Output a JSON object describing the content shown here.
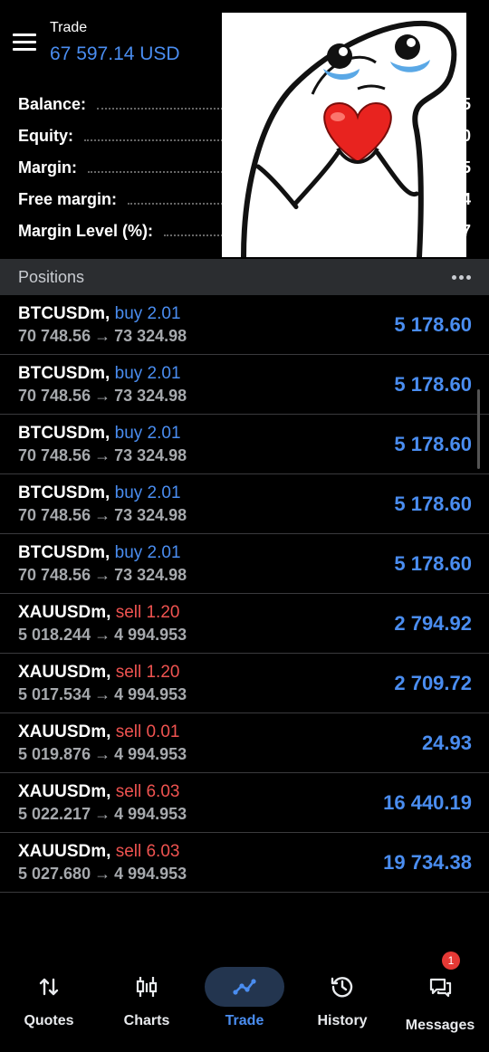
{
  "header": {
    "title": "Trade",
    "equity_display": "67 597.14 USD"
  },
  "summary": [
    {
      "label": "Balance:",
      "value": "5"
    },
    {
      "label": "Equity:",
      "value": "0"
    },
    {
      "label": "Margin:",
      "value": "5"
    },
    {
      "label": "Free margin:",
      "value": "4"
    },
    {
      "label": "Margin Level (%):",
      "value": "7"
    }
  ],
  "positions_section": {
    "title": "Positions"
  },
  "positions": [
    {
      "symbol": "BTCUSDm,",
      "side": "buy 2.01",
      "dir": "buy",
      "open": "70 748.56",
      "arrow": "→",
      "current": "73 324.98",
      "profit": "5 178.60"
    },
    {
      "symbol": "BTCUSDm,",
      "side": "buy 2.01",
      "dir": "buy",
      "open": "70 748.56",
      "arrow": "→",
      "current": "73 324.98",
      "profit": "5 178.60"
    },
    {
      "symbol": "BTCUSDm,",
      "side": "buy 2.01",
      "dir": "buy",
      "open": "70 748.56",
      "arrow": "→",
      "current": "73 324.98",
      "profit": "5 178.60"
    },
    {
      "symbol": "BTCUSDm,",
      "side": "buy 2.01",
      "dir": "buy",
      "open": "70 748.56",
      "arrow": "→",
      "current": "73 324.98",
      "profit": "5 178.60"
    },
    {
      "symbol": "BTCUSDm,",
      "side": "buy 2.01",
      "dir": "buy",
      "open": "70 748.56",
      "arrow": "→",
      "current": "73 324.98",
      "profit": "5 178.60"
    },
    {
      "symbol": "XAUUSDm,",
      "side": "sell 1.20",
      "dir": "sell",
      "open": "5 018.244",
      "arrow": "→",
      "current": "4 994.953",
      "profit": "2 794.92"
    },
    {
      "symbol": "XAUUSDm,",
      "side": "sell 1.20",
      "dir": "sell",
      "open": "5 017.534",
      "arrow": "→",
      "current": "4 994.953",
      "profit": "2 709.72"
    },
    {
      "symbol": "XAUUSDm,",
      "side": "sell 0.01",
      "dir": "sell",
      "open": "5 019.876",
      "arrow": "→",
      "current": "4 994.953",
      "profit": "24.93"
    },
    {
      "symbol": "XAUUSDm,",
      "side": "sell 6.03",
      "dir": "sell",
      "open": "5 022.217",
      "arrow": "→",
      "current": "4 994.953",
      "profit": "16 440.19"
    },
    {
      "symbol": "XAUUSDm,",
      "side": "sell 6.03",
      "dir": "sell",
      "open": "5 027.680",
      "arrow": "→",
      "current": "4 994.953",
      "profit": "19 734.38"
    }
  ],
  "nav": [
    {
      "label": "Quotes",
      "icon": "quotes-arrows-icon",
      "active": false
    },
    {
      "label": "Charts",
      "icon": "candlestick-icon",
      "active": false
    },
    {
      "label": "Trade",
      "icon": "trend-line-icon",
      "active": true
    },
    {
      "label": "History",
      "icon": "history-clock-icon",
      "active": false
    },
    {
      "label": "Messages",
      "icon": "messages-icon",
      "active": false,
      "badge": "1"
    }
  ],
  "colors": {
    "accent": "#4a8df0",
    "sell": "#ef5350",
    "buy": "#4a8df0",
    "background": "#000000",
    "section_header": "#2b2d30",
    "nav_active_pill": "#23354f",
    "badge": "#e53935"
  },
  "sticker": {
    "icon": "crying-character-holding-heart-sticker"
  }
}
